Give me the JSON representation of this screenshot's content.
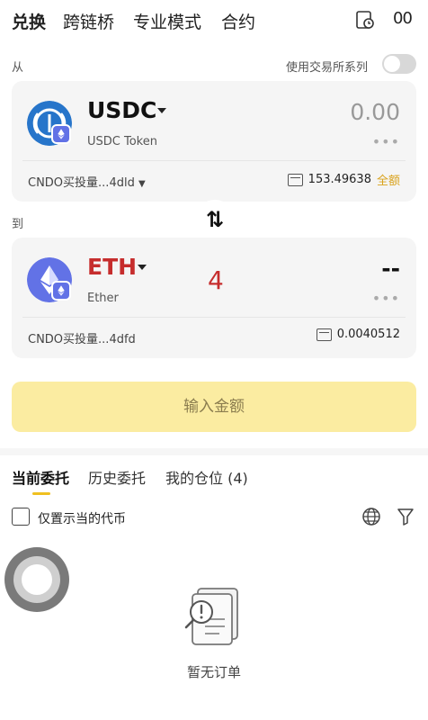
{
  "nav": {
    "tabs": [
      "兑换",
      "跨链桥",
      "专业模式",
      "合约"
    ],
    "active_tab": "兑换",
    "history_icon": "order-history-icon",
    "more_label": "00"
  },
  "from": {
    "label": "从",
    "toggle_label": "使用交易所系列",
    "toggle_on": false,
    "token_symbol": "USDC",
    "token_name": "USDC Token",
    "amount": "0.00",
    "dots": "•••",
    "account": "CNDO买投量...4dld",
    "balance": "153.49638",
    "all_label": "全额"
  },
  "to": {
    "label": "到",
    "token_symbol": "ETH",
    "token_name": "Ether",
    "amount": "--",
    "dots": "•••",
    "account": "CNDO买投量...4dfd",
    "balance": "0.0040512"
  },
  "swap_glyph": "⇅",
  "badge_number": "4",
  "action_button": "输入金额",
  "orders": {
    "tabs": [
      "当前委托",
      "历史委托",
      "我的仓位 (4)"
    ],
    "active_tab": "当前委托",
    "checkbox_label": "仅置示当的代币",
    "empty_text": "暂无订单"
  },
  "colors": {
    "accent": "#f0c020",
    "action_bg": "#fbeca1",
    "eth_symbol": "#c62d2d",
    "usdc_blue": "#2775ca",
    "eth_purple": "#6272e6"
  }
}
